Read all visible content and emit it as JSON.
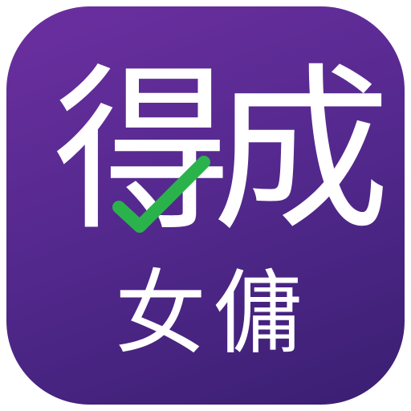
{
  "app_icon": {
    "line1": [
      "得",
      "成"
    ],
    "line2": [
      "女",
      "傭"
    ],
    "colors": {
      "background_top": "#6c2fa0",
      "background_bottom": "#3a1f72",
      "text": "#ffffff",
      "check": "#2bb34b"
    },
    "icons": [
      "checkmark-icon"
    ]
  }
}
